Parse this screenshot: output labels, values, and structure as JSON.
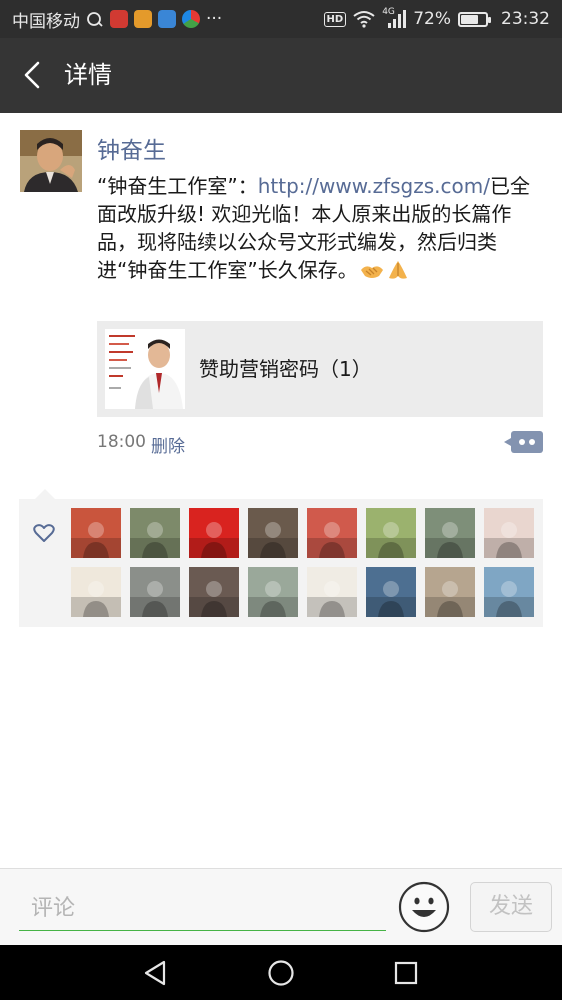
{
  "status_bar": {
    "carrier": "中国移动",
    "hd": "HD",
    "network": "4G",
    "battery_text": "72%",
    "battery_level": 0.72,
    "time": "23:32",
    "more_indicator": "···"
  },
  "header": {
    "title": "详情",
    "back_icon": "chevron-left-icon"
  },
  "post": {
    "author": "钟奋生",
    "text_before_link": "“钟奋生工作室”：",
    "link": "http://www.zfsgzs.com/",
    "text_after_link": "已全面改版升级! 欢迎光临！本人原来出版的长篇作品，现将陆续以公众号文形式编发，然后归类进“钟奋生工作室”长久保存。",
    "emojis": [
      "handshake-emoji",
      "folded-hands-emoji"
    ],
    "shared_item": {
      "title": "赞助营销密码（1）"
    },
    "time": "18:00",
    "delete_label": "删除",
    "more_icon": "comment-more-icon"
  },
  "likes": {
    "icon": "heart-outline-icon",
    "likers": [
      {
        "name": "liker-1",
        "color": "#c9553d"
      },
      {
        "name": "liker-2",
        "color": "#7d8a6a"
      },
      {
        "name": "liker-3",
        "color": "#d9231f"
      },
      {
        "name": "liker-4",
        "color": "#6a5a4c"
      },
      {
        "name": "liker-5",
        "color": "#d05a4c"
      },
      {
        "name": "liker-6",
        "color": "#9bb26e"
      },
      {
        "name": "liker-7",
        "color": "#7e8f79"
      },
      {
        "name": "liker-8",
        "color": "#e9d6cf"
      },
      {
        "name": "liker-9",
        "color": "#efe8dc"
      },
      {
        "name": "liker-10",
        "color": "#8b8f8a"
      },
      {
        "name": "liker-11",
        "color": "#6a5a52"
      },
      {
        "name": "liker-12",
        "color": "#9aa89a"
      },
      {
        "name": "liker-13",
        "color": "#f0ece4"
      },
      {
        "name": "liker-14",
        "color": "#4d6f91"
      },
      {
        "name": "liker-15",
        "color": "#b6a58f"
      },
      {
        "name": "liker-16",
        "color": "#7fa6c4"
      }
    ]
  },
  "comment_bar": {
    "placeholder": "评论",
    "emoji_icon": "smiley-icon",
    "send_label": "发送"
  },
  "nav_bar": {
    "back_icon": "nav-back-icon",
    "home_icon": "nav-home-icon",
    "recents_icon": "nav-recents-icon"
  },
  "colors": {
    "link": "#576b95",
    "header_bg": "#353535",
    "status_bg": "#2e2e2e",
    "input_underline": "#46b346"
  }
}
